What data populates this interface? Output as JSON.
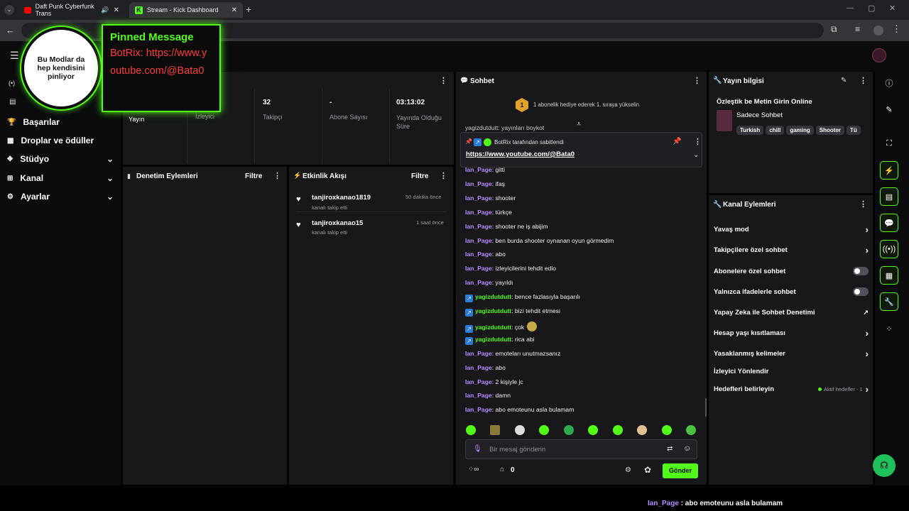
{
  "browser": {
    "tabs": [
      {
        "title": "Daft Punk Cyberfunk Trans"
      },
      {
        "title": "Stream - Kick Dashboard"
      }
    ]
  },
  "overlay": {
    "circle_text": "Bu Modlar da hep kendisini pinliyor",
    "pinned_title": "Pinned Message",
    "pinned_body": "BotRix: https://www.youtube.com/@Bata0"
  },
  "sidebar": {
    "items": [
      {
        "label": "Başarılar",
        "icon": "trophy-icon"
      },
      {
        "label": "Droplar ve ödüller",
        "icon": "gift-icon"
      },
      {
        "label": "Stüdyo",
        "icon": "studio-icon",
        "chevron": "⌄"
      },
      {
        "label": "Kanal",
        "icon": "channel-icon",
        "chevron": "⌄"
      },
      {
        "label": "Ayarlar",
        "icon": "gear-icon",
        "chevron": "⌄"
      }
    ]
  },
  "stats": [
    {
      "value": "",
      "label": "Yayın"
    },
    {
      "value": "",
      "label": "İzleyici"
    },
    {
      "value": "32",
      "label": "Takipçi"
    },
    {
      "value": "-",
      "label": "Abone Sayısı"
    },
    {
      "value": "03:13:02",
      "label": "Yayında Olduğu Süre"
    }
  ],
  "mod_panel": {
    "title": "Denetim Eylemleri",
    "filter": "Filtre"
  },
  "activity": {
    "title": "Etkinlik Akışı",
    "filter": "Filtre",
    "items": [
      {
        "user": "tanjiroxkanao1819",
        "action": "kanalı takip etti",
        "time": "50 dakika önce"
      },
      {
        "user": "tanjiroxkanao15",
        "action": "kanalı takip etti",
        "time": "1 saat önce"
      }
    ]
  },
  "chat": {
    "title": "Sohbet",
    "gift_banner": "1 abonelik hediye ederek 1. sıraya yükselin",
    "gift_rank": "1",
    "partial_line": "yagizdutdutt: yayınları boykot",
    "pinned_by": "BotRix tarafından sabitlendi",
    "pinned_link": "https://www.youtube.com/@Bata0",
    "messages": [
      {
        "user": "Ian_Page",
        "text": ": gitti"
      },
      {
        "user": "Ian_Page",
        "text": ": ifaş"
      },
      {
        "user": "Ian_Page",
        "text": ": shooter"
      },
      {
        "user": "Ian_Page",
        "text": ": türkçe"
      },
      {
        "user": "Ian_Page",
        "text": ": shooter ne iş abijim"
      },
      {
        "user": "Ian_Page",
        "text": ": ben burda shooter oynanan oyun görmedim"
      },
      {
        "user": "Ian_Page",
        "text": ": abo"
      },
      {
        "user": "Ian_Page",
        "text": ": izleyicilerini tehdit edio"
      },
      {
        "user": "Ian_Page",
        "text": ": yayıldı"
      },
      {
        "user": "yagizdutdutt",
        "text": ": bence fazlasıyla başarılı"
      },
      {
        "user": "yagizdutdutt",
        "text": ": bizi tehdit etmesi"
      },
      {
        "user": "yagizdutdutt",
        "text": ": çok"
      },
      {
        "user": "yagizdutdutt",
        "text": ": rica abi"
      },
      {
        "user": "Ian_Page",
        "text": ": emoteları unutmazsanız"
      },
      {
        "user": "Ian_Page",
        "text": ": abo"
      },
      {
        "user": "Ian_Page",
        "text": ": 2 kişiyle jc"
      },
      {
        "user": "Ian_Page",
        "text": ": damn"
      },
      {
        "user": "Ian_Page",
        "text": ": abo emoteunu asla bulamam"
      }
    ],
    "input_placeholder": "Bir mesaj gönderin",
    "points": "0",
    "send_label": "Gönder"
  },
  "stream_info": {
    "title": "Yayın bilgisi",
    "stream_title": "Özleştik be Metin Girin Online",
    "category": "Sadece Sohbet",
    "tags": [
      "Turkish",
      "chill",
      "gaming",
      "Shooter",
      "Tü"
    ]
  },
  "channel_actions": {
    "title": "Kanal Eylemleri",
    "rows": [
      {
        "label": "Yavaş mod",
        "control": "arrow"
      },
      {
        "label": "Takipçilere özel sohbet",
        "control": "arrow"
      },
      {
        "label": "Abonelere özel sohbet",
        "control": "toggle"
      },
      {
        "label": "Yalnızca ifadelerle sohbet",
        "control": "toggle"
      },
      {
        "label": "Yapay Zeka ile Sohbet Denetimi",
        "control": "external"
      },
      {
        "label": "Hesap yaşı kısıtlaması",
        "control": "arrow"
      },
      {
        "label": "Yasaklanmış kelimeler",
        "control": "arrow"
      },
      {
        "label": "İzleyici Yönlendir",
        "control": "none"
      },
      {
        "label": "Hedefleri belirleyin",
        "control": "arrow"
      }
    ],
    "goals_status": "Aktif hedefler - 1"
  },
  "caption": {
    "user": "Ian_Page",
    "text": " : abo emoteunu asla bulamam"
  },
  "colors": {
    "accent": "#53fc18",
    "panel": "#18181b",
    "username": "#b58bff"
  }
}
